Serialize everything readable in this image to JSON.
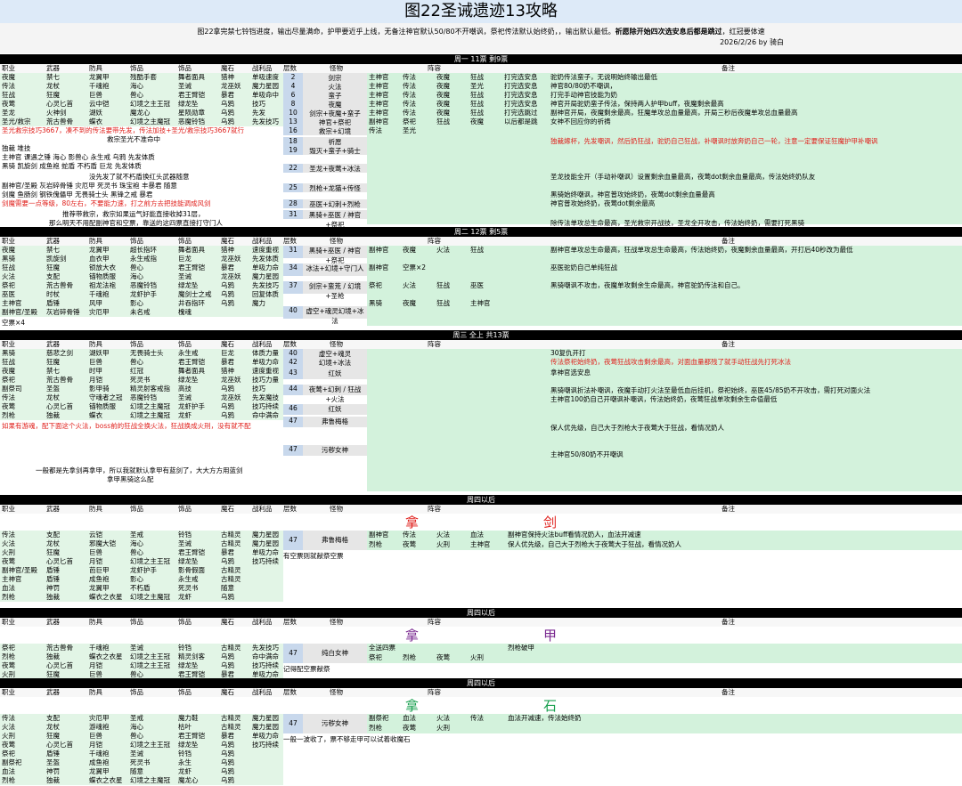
{
  "title": "图22圣诫遗迹13攻略",
  "intro": {
    "line1": "图22拿完禁七铃铛进度，输出尽量满命，护甲要近乎上线，无备注神官默认50/80不开嘲讽，祭祀传法默认始终奶，，输出默认最低。",
    "line1_bold": "祈愿除开始四次选安息后都是跳过",
    "line1_tail": "，红冠要体速",
    "date": "2026/2/26 by 骑白"
  },
  "col_headers": [
    "职业",
    "武器",
    "防具",
    "饰品",
    "饰品",
    "魔石",
    "战利品",
    "层数",
    "怪物",
    "阵容",
    "备注"
  ],
  "bars": {
    "week1": "周一 11票 剩9票",
    "week2": "周二 12票 剩5票",
    "week3": "周三 全上 共13票",
    "week4a": "周四以后",
    "week4b": "周四以后",
    "week4c": "周四以后"
  },
  "big_labels": {
    "sword": [
      "拿",
      "剑"
    ],
    "armor": [
      "拿",
      "甲"
    ],
    "stone": [
      "拿",
      "石"
    ]
  },
  "week1": {
    "gear": [
      [
        "夜魔",
        "禁七",
        "龙翼甲",
        "残酷手套",
        "舞者面具",
        "猎神",
        "单吸速度"
      ],
      [
        "传法",
        "龙杖",
        "千魂袍",
        "海心",
        "圣诫",
        "龙巫妖",
        "魔力星园"
      ],
      [
        "狂战",
        "狂魔",
        "巨兽",
        "兽心",
        "君王臂铠",
        "暴君",
        "单吸命中"
      ],
      [
        "夜莺",
        "心灵匕首",
        "云中铠",
        "幻境之主王冠",
        "绿龙坠",
        "乌鸦",
        "技巧"
      ],
      [
        "圣龙",
        "火神剑",
        "湖妖",
        "魔龙心",
        "星陨勋章",
        "乌鸦",
        "先发"
      ],
      [
        "圣光/救宗",
        "荒古兽骨",
        "蝶衣",
        "幻境之主魔冠",
        "恶魔铃铛",
        "乌鸦",
        "先发技巧"
      ]
    ],
    "notes": [
      "圣光救宗技巧3667，凑不到的传法要带先发，传法加技+圣光/救宗技巧3667就行",
      "救宗圣光不准命中",
      "独裁  堆技",
      "主神官  课遇之锤  海心  影兽心  永生戒  乌鸦  先发体质",
      "黑骑  凯旋剑  成鱼袍  蛇盾  不朽盾  巨龙  先发体质",
      "没先发了就不朽盾换红头武器随意",
      "副神官/圣殿  灰岩碎骨锤  灾厄甲  死灵书  珠宝袍  丰暴君  随意",
      "剑魔  鱼肠剑  钢铁傀儡甲  无畏骑士头  黑锋之戒  暴君",
      "剑魔需要一点等级，80左右，不要能力速，打之前方去把技能调成风剑",
      "推荐带救宗，救宗如果运气好能直接收掉31层，",
      "那么明天不用配副神官和空票，靠送的这四票直接打守门人"
    ],
    "floors": [
      [
        "2",
        "剑宗"
      ],
      [
        "4",
        "火法"
      ],
      [
        "6",
        "蛮子"
      ],
      [
        "8",
        "夜魔"
      ],
      [
        "10",
        "剑宗+夜魔+蛮子"
      ],
      [
        "13",
        "神官+祭祀"
      ],
      [
        "16",
        "救宗+幻境"
      ],
      [
        "18",
        "祈愿"
      ],
      [
        "19",
        "毁灭+蛮子+骑士"
      ],
      [
        "22",
        "圣龙+夜莺+冰法"
      ],
      [
        "25",
        "烈枪+龙猫+传怪"
      ],
      [
        "28",
        "巫医+幻刺+烈枪"
      ],
      [
        "31",
        "黑骑+巫医 / 神官+祭祀"
      ]
    ],
    "lineup": [
      [
        "主神官",
        "传法",
        "夜魔",
        "狂战",
        "打完选安息"
      ],
      [
        "主神官",
        "传法",
        "夜魔",
        "圣光",
        "打完选安息"
      ],
      [
        "主神官",
        "传法",
        "夜魔",
        "狂战",
        "打完选安息"
      ],
      [
        "主神官",
        "传法",
        "夜魔",
        "狂战",
        "打完选安息"
      ],
      [
        "主神官",
        "传法",
        "夜魔",
        "狂战",
        "打完选跳过"
      ],
      [
        "副神官",
        "祭祀",
        "狂战",
        "夜魔",
        "以后都是跳过"
      ],
      [
        "传法",
        "圣光",
        "",
        "",
        ""
      ]
    ],
    "remarks": [
      "驼奶传法蛮子，无说明始终输出最低",
      "神官80/80奶不嘲讽，",
      "打完手动神官技能为奶",
      "神官开局驼奶蛮子传法，保持两人护甲buff，夜魔剩余最高",
      "副神官开局，夜魔剩余最高，狂魔单攻总血量最高，开局三秒后夜魔单攻总血量最高",
      "女神不回应你的祈祷",
      "独裁嫁杯，先发嘲讽，然后奶狂战，驼奶自己狂战，补嘲讽时放奔奶自己一轮，注意一定要保证狂魔护甲补嘲讽",
      "圣龙技能全开（手动补嘲讽）设置剩余血量最高，夜莺dot剩余血量最高，传法始终奶队友",
      "黑骑始终嘲讽，神官普攻始终奶，夜莺dot剩余血量最高",
      "神官普攻始终奶，夜莺dot剩余最高",
      "除传法单攻总生命最高，圣光救宗开战技，圣龙全开攻击，传法始终奶，需要打死黑骑"
    ]
  },
  "week2": {
    "gear": [
      [
        "夜魔",
        "禁七",
        "龙翼甲",
        "超长指环",
        "舞者面具",
        "猎神",
        "速度重视"
      ],
      [
        "黑骑",
        "凯旋剑",
        "血衣甲",
        "永生戒指",
        "巨龙",
        "龙巫妖",
        "先发体质"
      ],
      [
        "狂战",
        "狂魔",
        "锁放大衣",
        "兽心",
        "君王臂铠",
        "暴君",
        "单吸力命"
      ],
      [
        "火法",
        "支配",
        "锚物质服",
        "海心",
        "圣诫",
        "龙巫妖",
        "魔力星园"
      ],
      [
        "祭祀",
        "荒古兽骨",
        "祖龙法袍",
        "恶魔铃铛",
        "绿龙坠",
        "乌鸦",
        "先发技巧"
      ],
      [
        "巫医",
        "时杖",
        "千魂袍",
        "龙虾护手",
        "魔剑士之戒",
        "乌鸦",
        "回复体质"
      ],
      [
        "主神官",
        "盾锤",
        "风甲",
        "影心",
        "井吞指环",
        "乌鸦",
        "魔力"
      ],
      [
        "副神官/圣殿",
        "灰岩碎骨锤",
        "灾厄甲",
        "未名戒",
        "槐魂",
        ""
      ]
    ],
    "floors": [
      [
        "31",
        "黑骑+巫医 / 神官+祭祀"
      ],
      [
        "34",
        "冰法+幻境+守门人"
      ],
      [
        "37",
        "剑宗+蛮荒 / 幻境+圣枪"
      ],
      [
        "40",
        "虚空+魂灵幻境+冰法"
      ]
    ],
    "lineup": [
      [
        "副神官",
        "夜魔",
        "火法",
        "狂战"
      ],
      [
        "副神官",
        "空票×2",
        "",
        ""
      ],
      [
        "祭祀",
        "火法",
        "狂战",
        "巫医"
      ],
      [
        "黑骑",
        "夜魔",
        "狂战",
        "主神官"
      ]
    ],
    "remarks": [
      "副神官单攻总生命最高，狂战单攻总生命最高，传法始终奶，夜魔剩余血量最高，开打后40秒改为最低",
      "巫医驼奶自己单纯狂战",
      "黑骑嘲讽不攻击，夜魔单攻剩余生命最高，神官驼奶传法和自己。"
    ],
    "empty_note": "空票×4"
  },
  "week3": {
    "gear": [
      [
        "黑骑",
        "慈悲之剑",
        "湖妖甲",
        "无畏骑士头",
        "永生戒",
        "巨龙",
        "体质力量"
      ],
      [
        "狂战",
        "狂魔",
        "巨兽",
        "兽心",
        "君王臂铠",
        "暴君",
        "单吸力命"
      ],
      [
        "夜魔",
        "禁七",
        "时甲",
        "红冠",
        "舞者面具",
        "猎神",
        "速度重视"
      ],
      [
        "祭祀",
        "荒古兽骨",
        "月铠",
        "死灵书",
        "绿龙坠",
        "龙巫妖",
        "技巧力量"
      ],
      [
        "副祭司",
        "圣盔",
        "影甲骑",
        "精灵射客戒指",
        "高技",
        "乌鸦",
        "技巧"
      ],
      [
        "传法",
        "龙杖",
        "守魂者之冠",
        "恶魔铃铛",
        "圣诫",
        "龙巫妖",
        "先发魔技"
      ],
      [
        "夜莺",
        "心灵匕首",
        "锚物质服",
        "幻境之主魔冠",
        "龙虾护手",
        "乌鸦",
        "技巧持续"
      ],
      [
        "烈枪",
        "独裁",
        "蝶衣",
        "幻境之主魔冠",
        "龙虾",
        "乌鸦",
        "命中满命"
      ]
    ],
    "floors": [
      [
        "40",
        "虚空+魂灵"
      ],
      [
        "42",
        "幻境+冰法"
      ],
      [
        "43",
        "红妖"
      ],
      [
        "44",
        "夜莺+幻刺 / 狂战+火法"
      ],
      [
        "46",
        "红妖"
      ],
      [
        "47",
        "弗鲁梅格"
      ],
      [
        "47",
        "污秽女神"
      ]
    ],
    "remarks": [
      "30复仇开打",
      "传法祭祀始终奶，夜莺狂战攻击剩余最高，对面血量都残了就手动狂战先打死冰法",
      "拿神官选安息",
      "黑骑嘲讽折法补嘲讽，夜魔手动打火法至最低血后挂机，祭祀始终，巫医45/85奶不开攻击，需打死对面火法",
      "主神官100奶自己开嘲讽补嘲讽，传法始终奶，夜莺狂战单攻剩余生命值最低",
      "保人优先级，自己大于烈枪大于夜莺大于狂战，看情况奶人",
      "主神官50/80奶不开嘲讽"
    ],
    "red_note": "如果有游魂，配下面这个火法，boss前的狂战全换火法，狂战换成火刑，没有就不配",
    "bottom_note": "一般都是先拿剑再拿甲，所以我就默认拿甲有蓝剑了，大大方方用蓝剑",
    "bottom_note2": "拿甲黑骑这么配"
  },
  "week4_sword": {
    "floor": "47",
    "monster": "弗鲁梅格",
    "gear": [
      [
        "传法",
        "支配",
        "云铠",
        "圣戒",
        "铃铛",
        "古精灵",
        "魔力星园"
      ],
      [
        "火法",
        "龙杖",
        "邪魔大铠",
        "海心",
        "圣诫",
        "古精灵",
        "魔力星园"
      ],
      [
        "火刑",
        "狂魔",
        "巨兽",
        "兽心",
        "君王臂铠",
        "暴君",
        "单吸力命"
      ],
      [
        "夜莺",
        "心灵匕首",
        "月铠",
        "幻境之主王冠",
        "绿龙坠",
        "乌鸦",
        "技巧持续"
      ],
      [
        "副神官/圣殿",
        "盾锤",
        "芭巨甲",
        "龙虾护手",
        "影骨假面",
        "古精灵",
        ""
      ],
      [
        "主神官",
        "盾锤",
        "成鱼袍",
        "影心",
        "永生戒",
        "古精灵",
        ""
      ],
      [
        "血法",
        "神罚",
        "龙翼甲",
        "不朽盾",
        "死灵书",
        "随意",
        ""
      ],
      [
        "烈枪",
        "独裁",
        "蝶衣之衣星",
        "幻境之主魔冠",
        "龙虾",
        "乌鸦",
        ""
      ]
    ],
    "lineup": [
      [
        "副神官",
        "传法",
        "火法",
        "血法"
      ],
      [
        "烈枪",
        "夜莺",
        "火刑",
        "主神官"
      ]
    ],
    "remarks": [
      "副神官保持火法buff看情况奶人，血法开减速",
      "保人优先级，自己大于烈枪大于夜莺大于狂战，看情况奶人"
    ],
    "tail_note": "有空票则就献祭空票"
  },
  "week4_armor": {
    "floor": "47",
    "monster": "纯白女神",
    "gear": [
      [
        "祭祀",
        "荒古兽骨",
        "千魂袍",
        "圣诫",
        "铃铛",
        "古精灵",
        "先发技巧"
      ],
      [
        "烈枪",
        "独裁",
        "蝶衣之衣星",
        "幻境之主王冠",
        "精灵剑客",
        "乌鸦",
        "命中满命"
      ],
      [
        "夜莺",
        "心灵匕首",
        "月铠",
        "幻境之主王冠",
        "绿龙坠",
        "乌鸦",
        "技巧持续"
      ],
      [
        "火刑",
        "狂魔",
        "巨兽",
        "兽心",
        "君王臂铠",
        "暴君",
        "单吸力命"
      ]
    ],
    "lineup": [
      [
        "全送四票",
        ""
      ],
      [
        "祭祀",
        "烈枪",
        "夜莺",
        "火刑"
      ]
    ],
    "remarks": [
      "烈枪破甲"
    ],
    "tail_note": "记得配空票献祭"
  },
  "week4_stone": {
    "floor": "47",
    "monster": "污秽女神",
    "gear": [
      [
        "传法",
        "支配",
        "灾厄甲",
        "圣戒",
        "魔力鞋",
        "古精灵",
        "魔力星园"
      ],
      [
        "火法",
        "龙杖",
        "游魂袍",
        "海心",
        "枯叶",
        "古精灵",
        "魔力星园"
      ],
      [
        "火刑",
        "狂魔",
        "巨兽",
        "兽心",
        "君王臂铠",
        "暴君",
        "单吸力命"
      ],
      [
        "夜莺",
        "心灵匕首",
        "月铠",
        "幻境之主王冠",
        "绿龙坠",
        "乌鸦",
        "技巧持续"
      ],
      [
        "祭祀",
        "盾锤",
        "千魂袍",
        "圣诫",
        "铃铛",
        "乌鸦",
        ""
      ],
      [
        "副祭祀",
        "圣盔",
        "成鱼袍",
        "死灵书",
        "永生",
        "乌鸦",
        ""
      ],
      [
        "血法",
        "神罚",
        "龙翼甲",
        "随意",
        "龙虾",
        "乌鸦",
        ""
      ],
      [
        "烈枪",
        "独裁",
        "蝶衣之衣星",
        "幻境之主魔冠",
        "魔龙心",
        "乌鸦",
        ""
      ]
    ],
    "lineup": [
      [
        "副祭祀",
        "血法",
        "火法",
        "传法"
      ],
      [
        "烈枪",
        "夜莺",
        "火刑",
        ""
      ]
    ],
    "remarks": [
      "血法开减速，传法始终奶"
    ],
    "tail_note": "一般一波收了，票不够走甲可以试着收魔石"
  }
}
